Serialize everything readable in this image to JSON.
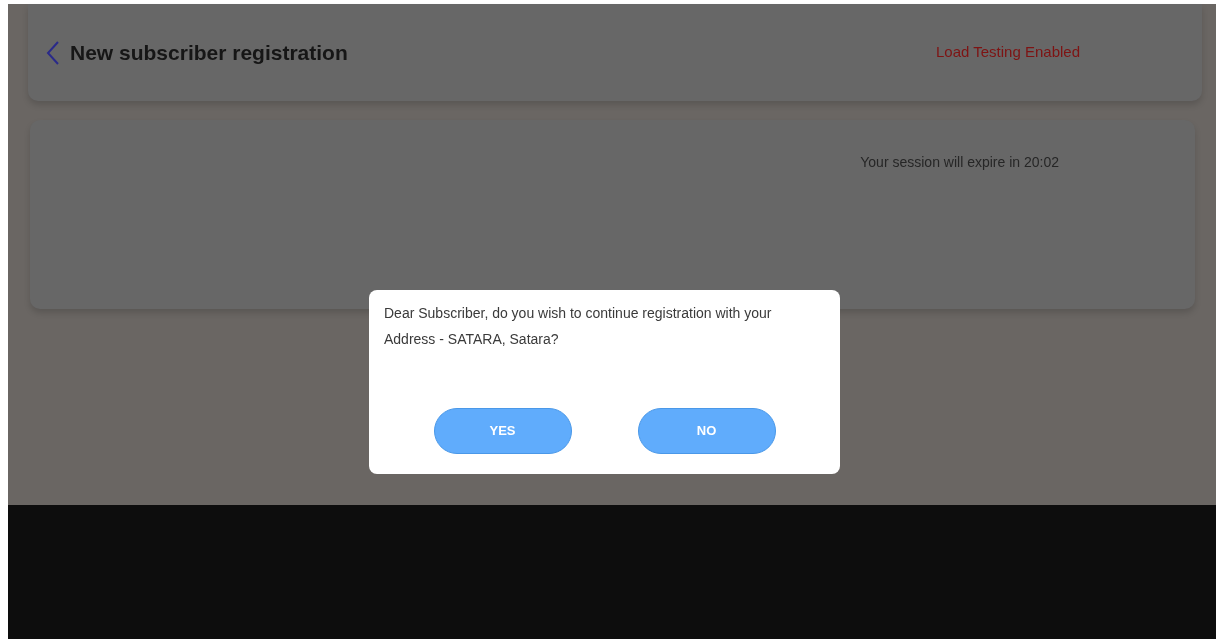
{
  "header": {
    "title": "New subscriber registration",
    "status": "Load Testing Enabled"
  },
  "session": {
    "message": "Your session will expire in 20:02"
  },
  "dialog": {
    "message": "Dear Subscriber, do you wish to continue registration with your Address - SATARA, Satara?",
    "buttons": [
      {
        "label": "YES"
      },
      {
        "label": "NO"
      }
    ]
  }
}
